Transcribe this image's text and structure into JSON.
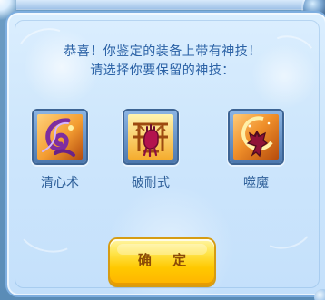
{
  "dialog": {
    "message_line_1": "恭喜！你鉴定的装备上带有神技！",
    "message_line_2": "请选择你要保留的神技："
  },
  "skills": [
    {
      "label": "清心术",
      "icon": "swirl-icon"
    },
    {
      "label": "破耐式",
      "icon": "fist-icon"
    },
    {
      "label": "噬魔",
      "icon": "wolf-icon"
    }
  ],
  "buttons": {
    "confirm_label": "确 定"
  },
  "colors": {
    "title_text": "#2a61a5",
    "skill_text": "#2e5f99",
    "button_gold": "#ffc800",
    "button_text": "#8b4a06"
  }
}
